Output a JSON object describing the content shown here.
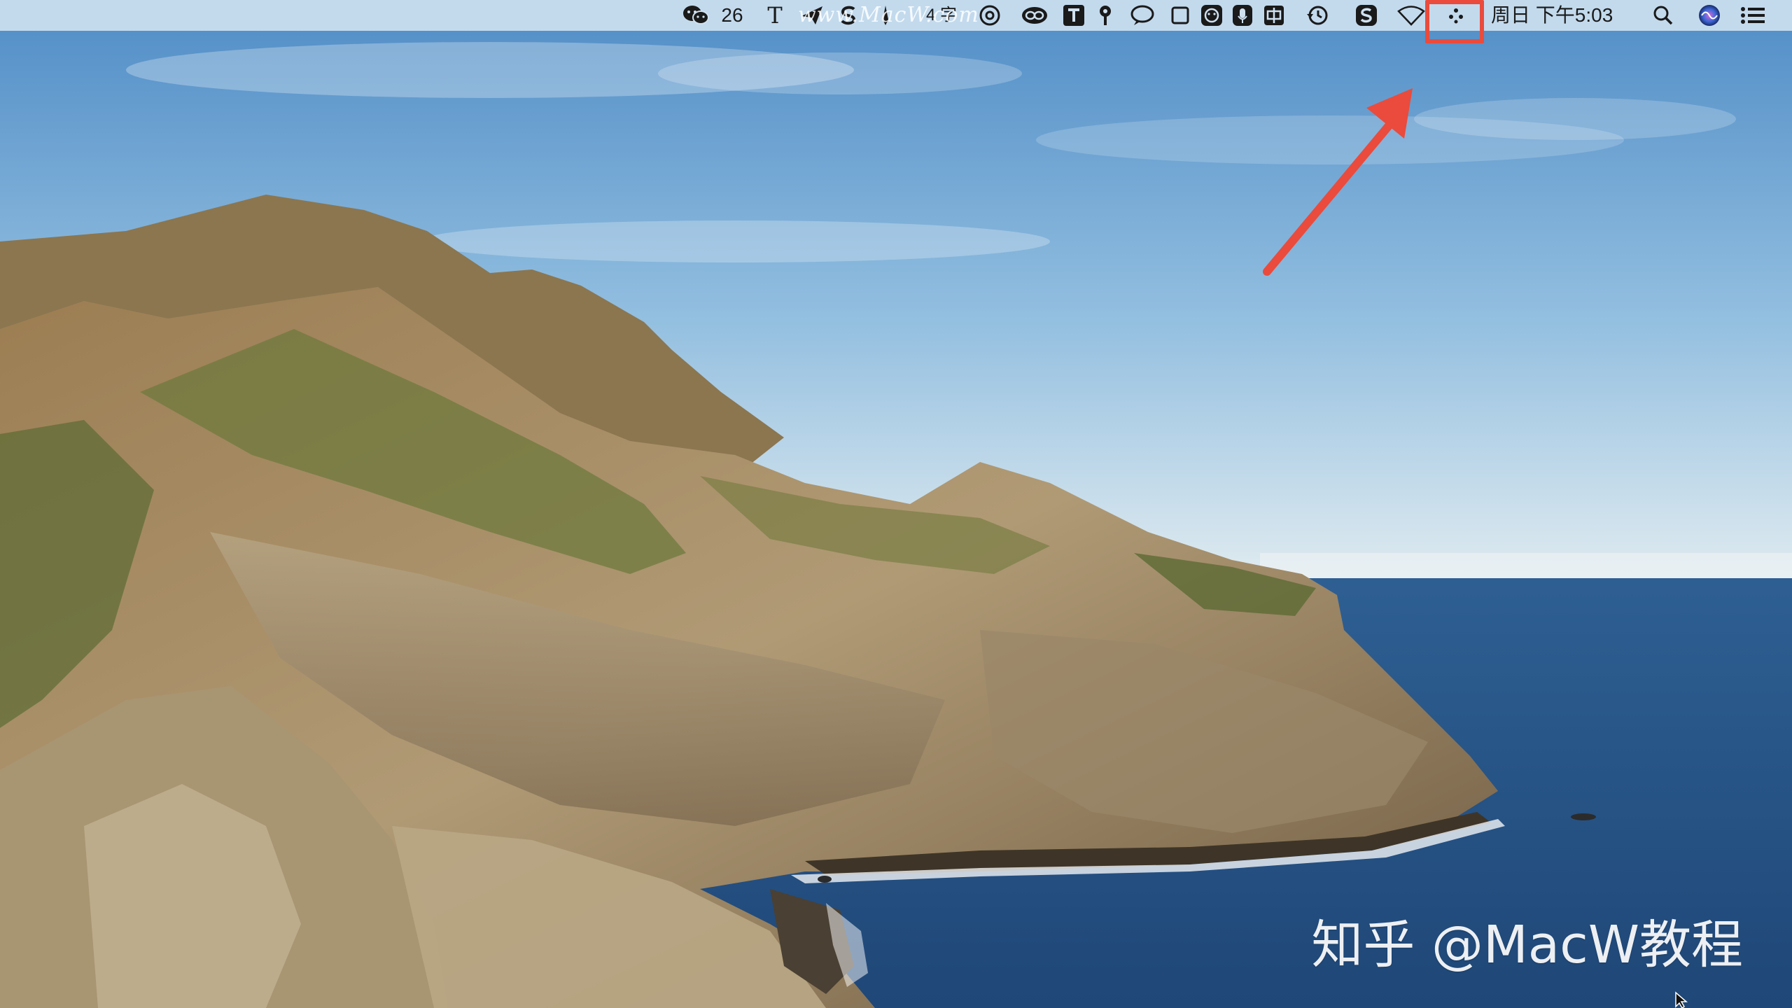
{
  "menubar": {
    "wechat_badge": "26",
    "typing_item": "T",
    "word_count": "4 字",
    "clock": "周日 下午5:03",
    "watermark": "www.MacW.com",
    "icons": [
      "wechat-icon",
      "text-tool-icon",
      "send-icon",
      "s-app-icon",
      "pen-icon",
      "at-sign-icon",
      "creative-cloud-icon",
      "t-app-icon",
      "pin-icon",
      "chat-bubble-icon",
      "window-square-icon",
      "emoji-face-icon",
      "microphone-icon",
      "chinese-input-icon",
      "time-machine-icon",
      "sogou-s-icon",
      "wifi-icon",
      "status-dots-icon",
      "spotlight-search-icon",
      "siri-icon",
      "notification-center-icon"
    ]
  },
  "overlay": {
    "watermark_text": "知乎 @MacW教程",
    "highlight_color": "#ea4b3c",
    "arrow_color": "#ea4b3c"
  },
  "wallpaper": {
    "sky_top": "#5d93c8",
    "sky_bottom": "#d6e6ef",
    "sea": "#2e5c8c",
    "cliff": "#a28a62"
  }
}
